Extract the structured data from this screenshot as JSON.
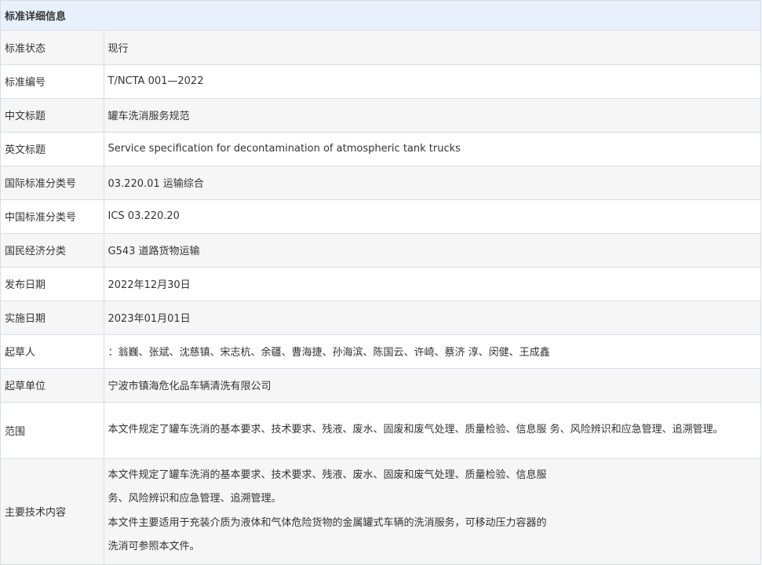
{
  "header": {
    "title": "标准详细信息"
  },
  "rows": {
    "status": {
      "label": "标准状态",
      "value": "现行"
    },
    "number": {
      "label": "标准编号",
      "value": "T/NCTA 001—2022"
    },
    "cn_title": {
      "label": "中文标题",
      "value": "罐车洗消服务规范"
    },
    "en_title": {
      "label": "英文标题",
      "value": "Service specification for decontamination of atmospheric tank trucks"
    },
    "ics": {
      "label": "国际标准分类号",
      "value": "03.220.01 运输综合"
    },
    "ccs": {
      "label": "中国标准分类号",
      "value": "ICS 03.220.20"
    },
    "economy": {
      "label": "国民经济分类",
      "value": "G543 道路货物运输"
    },
    "publish_date": {
      "label": "发布日期",
      "value": "2022年12月30日"
    },
    "implement_date": {
      "label": "实施日期",
      "value": "2023年01月01日"
    },
    "drafters": {
      "label": "起草人",
      "value": "：翁巍、张斌、沈慈镇、宋志杭、余疆、曹海捷、孙海滨、陈国云、许崎、蔡济 淳、闵健、王成鑫"
    },
    "drafting_unit": {
      "label": "起草单位",
      "value": "宁波市镇海危化品车辆清洗有限公司"
    },
    "scope": {
      "label": "范围",
      "value": "本文件规定了罐车洗消的基本要求、技术要求、残液、废水、固废和废气处理、质量检验、信息服 务、风险辨识和应急管理、追溯管理。"
    },
    "main_content": {
      "label": "主要技术内容",
      "lines": [
        "本文件规定了罐车洗消的基本要求、技术要求、残液、废水、固废和废气处理、质量检验、信息服",
        "务、风险辨识和应急管理、追溯管理。",
        "本文件主要适用于充装介质为液体和气体危险货物的金属罐式车辆的洗消服务，可移动压力容器的",
        "洗消可参照本文件。"
      ]
    }
  }
}
